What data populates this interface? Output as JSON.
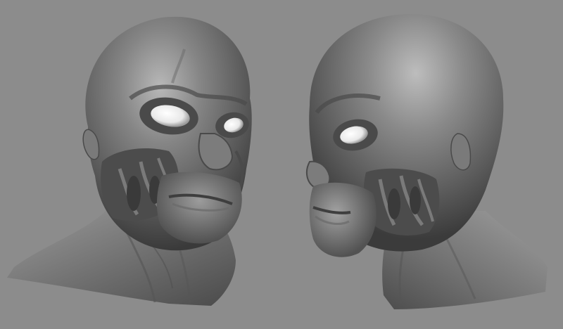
{
  "scene": {
    "background_color": "#8c8c8c",
    "material_color": "#6f6f6f",
    "subjects": [
      {
        "name": "alien-head-three-quarter-view",
        "facing": "front-right"
      },
      {
        "name": "alien-head-profile-view",
        "facing": "left"
      }
    ]
  }
}
